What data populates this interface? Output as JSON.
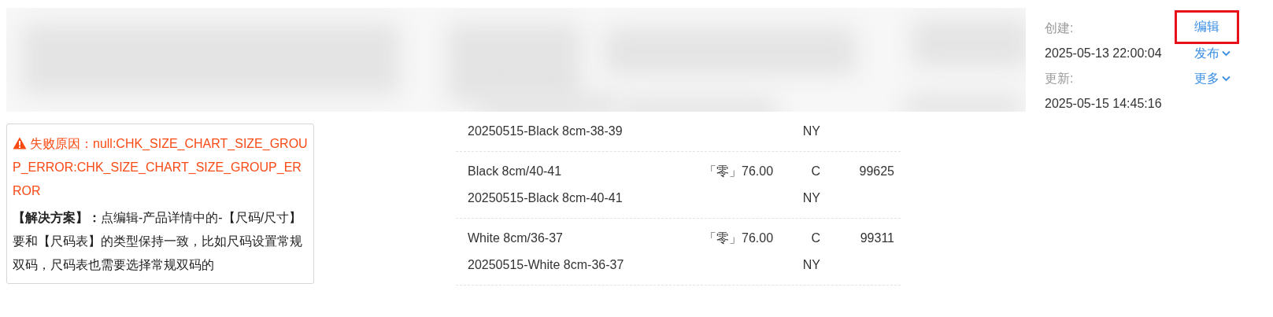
{
  "record_info": {
    "created_label": "创建:",
    "created_time": "2025-05-13 22:00:04",
    "updated_label": "更新:",
    "updated_time": "2025-05-15 14:45:16"
  },
  "actions": [
    {
      "label": "编辑",
      "kind": "link",
      "highlighted": true
    },
    {
      "label": "发布",
      "kind": "dropdown",
      "highlighted": false
    },
    {
      "label": "更多",
      "kind": "dropdown",
      "highlighted": false
    }
  ],
  "error": {
    "reason": "失败原因：null:CHK_SIZE_CHART_SIZE_GROUP_ERROR:CHK_SIZE_CHART_SIZE_GROUP_ERROR",
    "solution": "**【解决方案】：**点编辑-产品详情中的-【尺码/尺寸】要和【尺码表】的类型保持一致，比如尺码设置常规双码，尺码表也需要选择常规双码的"
  },
  "variants": [
    {
      "sku": "20250515-Black 8cm-38-39",
      "currency": [
        "NY"
      ]
    },
    {
      "name": "Black 8cm/40-41",
      "sku": "20250515-Black 8cm-40-41",
      "price": "「零」76.00",
      "currency": [
        "C",
        "NY"
      ],
      "stock": "99625"
    },
    {
      "name": "White 8cm/36-37",
      "sku": "20250515-White 8cm-36-37",
      "price": "「零」76.00",
      "currency": [
        "C",
        "NY"
      ],
      "stock": "99311"
    }
  ]
}
